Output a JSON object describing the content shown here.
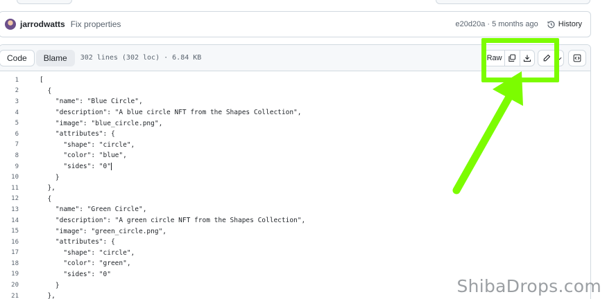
{
  "commit": {
    "author": "jarrodwatts",
    "message": "Fix properties",
    "sha_age": "e20d20a · 5 months ago",
    "history_label": "History"
  },
  "file_header": {
    "tab_code": "Code",
    "tab_blame": "Blame",
    "meta": "302 lines (302 loc) · 6.84 KB"
  },
  "toolbar": {
    "raw_label": "Raw"
  },
  "icons": {
    "copy": "copy-icon",
    "download": "download-icon",
    "edit": "pencil-icon",
    "symbols": "code-square-icon",
    "history": "history-icon"
  },
  "colors": {
    "highlight": "#7cfc00",
    "border": "#d1d9e0",
    "header_bg": "#f6f8fa"
  },
  "code_lines": [
    {
      "n": "1",
      "t": "["
    },
    {
      "n": "2",
      "t": "  {"
    },
    {
      "n": "3",
      "t": "    \"name\": \"Blue Circle\","
    },
    {
      "n": "4",
      "t": "    \"description\": \"A blue circle NFT from the Shapes Collection\","
    },
    {
      "n": "5",
      "t": "    \"image\": \"blue_circle.png\","
    },
    {
      "n": "6",
      "t": "    \"attributes\": {"
    },
    {
      "n": "7",
      "t": "      \"shape\": \"circle\","
    },
    {
      "n": "8",
      "t": "      \"color\": \"blue\","
    },
    {
      "n": "9",
      "t": "      \"sides\": \"0\""
    },
    {
      "n": "10",
      "t": "    }"
    },
    {
      "n": "11",
      "t": "  },"
    },
    {
      "n": "12",
      "t": "  {"
    },
    {
      "n": "13",
      "t": "    \"name\": \"Green Circle\","
    },
    {
      "n": "14",
      "t": "    \"description\": \"A green circle NFT from the Shapes Collection\","
    },
    {
      "n": "15",
      "t": "    \"image\": \"green_circle.png\","
    },
    {
      "n": "16",
      "t": "    \"attributes\": {"
    },
    {
      "n": "17",
      "t": "      \"shape\": \"circle\","
    },
    {
      "n": "18",
      "t": "      \"color\": \"green\","
    },
    {
      "n": "19",
      "t": "      \"sides\": \"0\""
    },
    {
      "n": "20",
      "t": "    }"
    },
    {
      "n": "21",
      "t": "  },"
    }
  ],
  "watermark": "ShibaDrops.com"
}
